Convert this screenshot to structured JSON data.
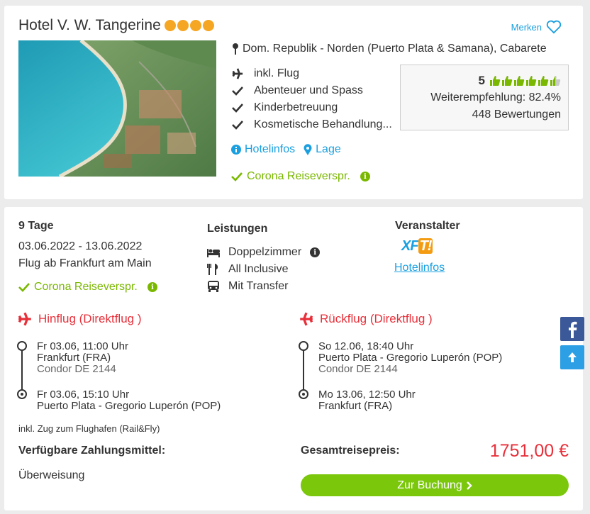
{
  "hotel": {
    "name": "Hotel V. W. Tangerine",
    "stars": 4,
    "merken_label": "Merken",
    "location": "Dom. Republik - Norden (Puerto Plata & Samana), Cabarete",
    "features": [
      {
        "icon": "plane-icon",
        "label": "inkl. Flug"
      },
      {
        "icon": "check-icon",
        "label": "Abenteuer und Spass"
      },
      {
        "icon": "check-icon",
        "label": "Kinderbetreuung"
      },
      {
        "icon": "check-icon",
        "label": "Kosmetische Behandlung..."
      }
    ],
    "rating": {
      "score": "5",
      "thumbs_filled": 5.5,
      "thumbs_total": 6,
      "recommendation": "Weiterempfehlung: 82.4%",
      "reviews": "448 Bewertungen"
    },
    "links": {
      "hotelinfos": "Hotelinfos",
      "lage": "Lage"
    },
    "corona": "Corona Reiseverspr."
  },
  "offer": {
    "duration": "9 Tage",
    "dates": "03.06.2022 - 13.06.2022",
    "departure": "Flug ab Frankfurt am Main",
    "corona": "Corona Reiseverspr.",
    "leistungen_title": "Leistungen",
    "leistungen": [
      {
        "icon": "bed-icon",
        "label": "Doppelzimmer"
      },
      {
        "icon": "cutlery-icon",
        "label": "All Inclusive"
      },
      {
        "icon": "bus-icon",
        "label": "Mit Transfer"
      }
    ],
    "veranstalter_title": "Veranstalter",
    "veranstalter_logo": "XFT!",
    "veranstalter_link": "Hotelinfos",
    "hinflug": {
      "title": "Hinflug (Direktflug )",
      "dep_time": "Fr 03.06, 11:00 Uhr",
      "dep_airport": "Frankfurt (FRA)",
      "airline": "Condor DE 2144",
      "arr_time": "Fr 03.06, 15:10 Uhr",
      "arr_airport": "Puerto Plata - Gregorio Luperón (POP)"
    },
    "rueckflug": {
      "title": "Rückflug (Direktflug )",
      "dep_time": "So 12.06, 18:40 Uhr",
      "dep_airport": "Puerto Plata - Gregorio Luperón (POP)",
      "airline": "Condor DE 2144",
      "arr_time": "Mo 13.06, 12:50 Uhr",
      "arr_airport": "Frankfurt (FRA)"
    },
    "rail_note": "inkl. Zug zum Flughafen (Rail&Fly)",
    "payment_title": "Verfügbare Zahlungsmittel:",
    "payment_method": "Überweisung",
    "price_label": "Gesamtreisepreis:",
    "price": "1751,00 €",
    "book_label": "Zur Buchung"
  },
  "colors": {
    "accent": "#1aa0e0",
    "green": "#7ab800",
    "red": "#e8303a",
    "star": "#f5a623",
    "button": "#7ac70c"
  }
}
